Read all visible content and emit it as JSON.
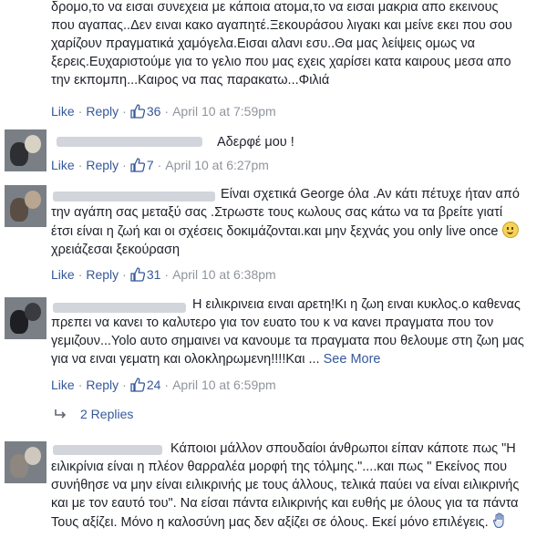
{
  "comments": [
    {
      "lines": [
        "δρομο,το να εισαι συνεχεια με κάποια ατομα,το να εισαι μακρια απο εκεινους",
        "που αγαπας..Δεν ειναι κακο αγαπητέ.Ξεκουράσου λιγακι και μείνε εκει που σου",
        "χαρίζουν πραγματικά χαμόγελα.Εισαι αλανι εσυ..Θα μας λείψεις ομως να",
        "ξερεις.Ευχαριστούμε για το γελιο που μας εχεις χαρίσει κατα καιρους μεσα απο",
        "την εκπομπη...Καιρος να πας παρακατω...Φιλιά"
      ],
      "like_label": "Like",
      "reply_label": "Reply",
      "likes": "36",
      "time": "April 10 at 7:59pm"
    },
    {
      "lines": [
        "Αδερφέ μου !"
      ],
      "like_label": "Like",
      "reply_label": "Reply",
      "likes": "7",
      "time": "April 10 at 6:27pm"
    },
    {
      "lines": [
        "Είναι σχετικά George όλα .Αν κάτι πέτυχε ήταν από",
        "την αγάπη σας μεταξύ σας .Στρωστε τους κωλους σας κάτω να τα βρείτε γιατί",
        "έτσι είναι η ζωή και οι σχέσεις δοκιμάζονται.και μην ξεχνάς you only live once",
        "χρειάζεσαι ξεκούραση"
      ],
      "like_label": "Like",
      "reply_label": "Reply",
      "likes": "31",
      "time": "April 10 at 6:38pm"
    },
    {
      "lines": [
        "Η ειλικρινεια ειναι αρετη!Κι η ζωη ειναι κυκλος.ο καθενας",
        "πρεπει να κανει το καλυτερο για τον ευατο του κ να κανει πραγματα που τον",
        "γεμιζουν...Yolo αυτο σημαινει να κανουμε τα πραγματα που θελουμε στη ζωη μας",
        "για να ειναι γεματη και ολοκληρωμενη!!!!Και ..."
      ],
      "see_more": "See More",
      "like_label": "Like",
      "reply_label": "Reply",
      "likes": "24",
      "time": "April 10 at 6:59pm",
      "replies_label": "2 Replies"
    },
    {
      "lines": [
        "Κάποιοι μάλλον σπουδαίοι άνθρωποι είπαν κάποτε πως \"Η",
        "ειλικρίνια είναι η πλέον θαρραλέα μορφή της τόλμης.\"....και πως \" Εκείνος που",
        "συνήθησε να μην είναι ειλικρινής με τους άλλους, τελικά παύει να είναι ειλικρινής",
        "και με τον εαυτό του\". Να είσαι πάντα ειλικρινής και ευθής με όλους για τα πάντα",
        "Τους αξίζει. Μόνο η καλοσύνη μας δεν αξίζει σε όλους. Εκεί μόνο επιλέγεις."
      ]
    }
  ]
}
